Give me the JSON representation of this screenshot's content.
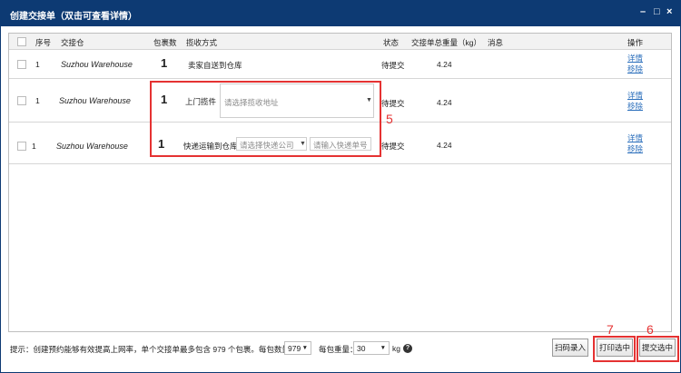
{
  "window": {
    "title": "创建交接单（双击可查看详情）",
    "minimize_glyph": "–",
    "maximize_glyph": "□",
    "close_glyph": "×"
  },
  "table": {
    "headers": {
      "index": "序号",
      "warehouse": "交接仓",
      "package_count": "包裹数",
      "pickup_method": "揽收方式",
      "status": "状态",
      "total_weight": "交接单总重量（kg）",
      "message": "消息",
      "action": "操作"
    },
    "rows": [
      {
        "index": "1",
        "warehouse": "Suzhou Warehouse",
        "package_count": "1",
        "method": "卖家自送到仓库",
        "status": "待提交",
        "weight": "4.24",
        "action_detail": "详情",
        "action_remove": "移除"
      },
      {
        "index": "1",
        "warehouse": "Suzhou Warehouse",
        "package_count": "1",
        "method": "上门揽件",
        "address_placeholder": "请选择揽收地址",
        "status": "待提交",
        "weight": "4.24",
        "action_detail": "详情",
        "action_remove": "移除"
      },
      {
        "index": "1",
        "warehouse": "Suzhou Warehouse",
        "package_count": "1",
        "method": "快递运输到仓库",
        "courier_placeholder": "请选择快递公司",
        "tracking_placeholder": "请输入快递单号",
        "status": "待提交",
        "weight": "4.24",
        "action_detail": "详情",
        "action_remove": "移除"
      }
    ]
  },
  "annotations": {
    "marker_5": "5",
    "marker_6": "6",
    "marker_7": "7"
  },
  "footer": {
    "tip": "提示：创建预约能够有效提高上网率，单个交接单最多包含 979 个包裹。每包数量：",
    "per_package_count": "979",
    "weight_label": "每包重量：",
    "per_package_weight": "30",
    "unit": "kg",
    "help_glyph": "?",
    "scan_button": "扫码录入",
    "print_button": "打印选中",
    "submit_button": "提交选中"
  },
  "colors": {
    "titlebar": "#0d3a73",
    "annotation": "#e53232",
    "link": "#2a6ebb"
  }
}
